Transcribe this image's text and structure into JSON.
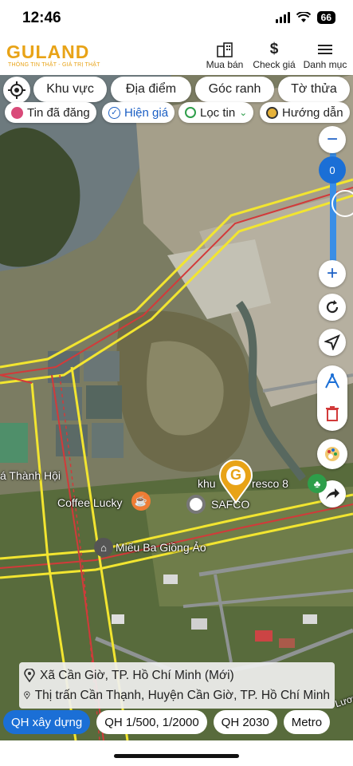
{
  "status": {
    "time": "12:46",
    "battery": "66"
  },
  "app": {
    "logo": "GULAND",
    "tagline": "THÔNG TIN THẬT - GIÁ TRỊ THẬT",
    "nav": [
      {
        "label": "Mua bán",
        "icon": "building-icon"
      },
      {
        "label": "Check giá",
        "icon": "dollar-icon"
      },
      {
        "label": "Danh mục",
        "icon": "menu-icon"
      }
    ]
  },
  "filters": {
    "row1": [
      "Khu vực",
      "Địa điểm",
      "Góc ranh",
      "Tờ thửa"
    ],
    "row2": [
      {
        "label": "Tin đã đăng",
        "icon": "pin-list-icon"
      },
      {
        "label": "Hiện giá",
        "icon": "check-circle-icon",
        "active": true
      },
      {
        "label": "Lọc tin",
        "icon": "location-filter-icon"
      },
      {
        "label": "Hướng dẫn",
        "icon": "guide-icon"
      }
    ]
  },
  "map_controls": {
    "zoom_value": "0",
    "zoom_in": "+",
    "zoom_out": "−"
  },
  "map_labels": {
    "place1": "á Thành Hội",
    "place2": "Coffee Lucky",
    "place3": "SAFCO",
    "place4": "khu",
    "place5": "resco 8",
    "place6": "Miếu Ba Giồng Ảo",
    "road": "Lương",
    "marker": "G"
  },
  "address": {
    "new": "Xã Cần Giờ, TP. Hồ Chí Minh (Mới)",
    "old": "Thị trấn Cần Thạnh, Huyện Cần Giờ, TP. Hồ Chí Minh"
  },
  "bottom_tabs": [
    {
      "label": "QH xây dựng",
      "active": true
    },
    {
      "label": "QH 1/500, 1/2000"
    },
    {
      "label": "QH 2030"
    },
    {
      "label": "Metro"
    }
  ],
  "colors": {
    "accent": "#1b6fd6",
    "brand": "#e8a317",
    "road_yellow": "#f2e530",
    "road_red": "#d23a3a"
  }
}
